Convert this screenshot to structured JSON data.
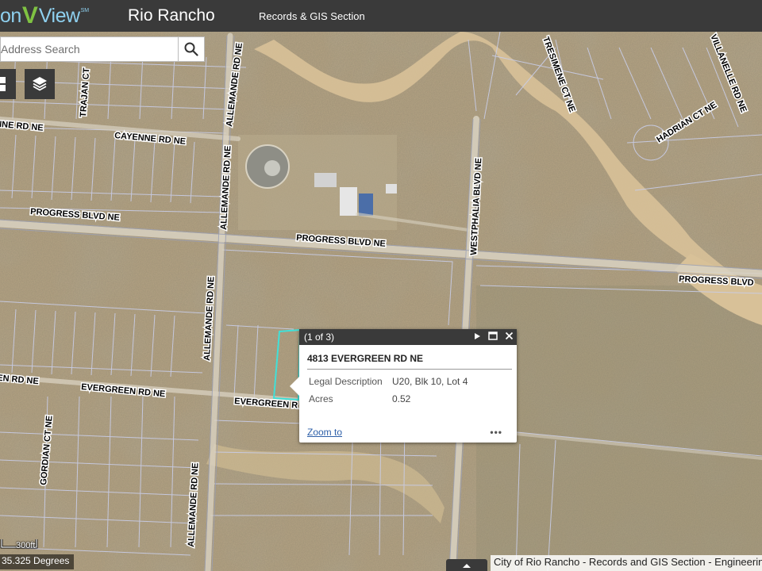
{
  "header": {
    "logo_left": "on",
    "logo_v": "V",
    "logo_right": "View",
    "logo_sm": "SM",
    "title": "Rio Rancho",
    "subtitle": "Records & GIS Section"
  },
  "search": {
    "placeholder": "Address Search",
    "icon": "search-icon"
  },
  "map_buttons": [
    {
      "icon": "basemap-grid-icon"
    },
    {
      "icon": "layers-icon"
    }
  ],
  "street_labels": {
    "l1": "NNE RD NE",
    "l2": "CAYENNE RD NE",
    "l3": "PROGRESS BLVD NE",
    "l4": "PROGRESS BLVD NE",
    "l5": "PROGRESS BLVD",
    "l6": "EN RD NE",
    "l7": "EVERGREEN RD NE",
    "l8": "EVERGREEN R",
    "l9": "TRAJAN CT",
    "l10": "ALLEMANDE RD NE",
    "l11": "ALLEMANDE RD NE",
    "l12": "ALLEMANDE RD NE",
    "l13": "ALLEMANDE RD NE",
    "l14": "WESTPHALIA BLVD NE",
    "l15": "TRESIMENE CT NE",
    "l16": "VILLANELLE RD NE",
    "l17": "HADRIAN CT NE",
    "l18": "GORDIAN CT NE"
  },
  "popup": {
    "count": "(1 of 3)",
    "title": "4813 EVERGREEN RD NE",
    "rows": [
      {
        "key": "Legal Description",
        "value": "U20, Blk 10, Lot 4"
      },
      {
        "key": "Acres",
        "value": "0.52"
      }
    ],
    "zoom_label": "Zoom to",
    "more_label": "•••"
  },
  "scale": {
    "label": "300ft"
  },
  "coordinates": "35.325 Degrees",
  "attribution": "City of Rio Rancho - Records and GIS Section - Engineering",
  "colors": {
    "header_bg": "#3a3a3a",
    "parcel_line": "#c9cde8",
    "selected_parcel": "#40e0d8",
    "link": "#2d5fa8"
  }
}
